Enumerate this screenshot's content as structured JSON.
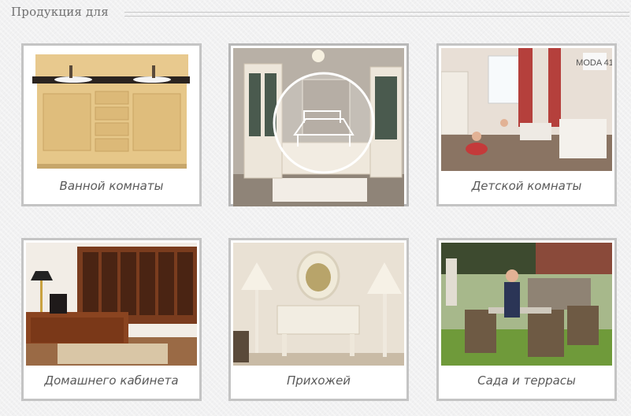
{
  "header": {
    "title": "Продукция для"
  },
  "products": [
    {
      "caption": "Ванной комнаты",
      "icon": "bathroom-vanity-image"
    },
    {
      "caption": "",
      "icon": "living-room-showcase-image"
    },
    {
      "caption": "Детской комнаты",
      "icon": "kids-room-image",
      "badge_text": "MODA 41"
    },
    {
      "caption": "Домашнего кабинета",
      "icon": "home-office-image"
    },
    {
      "caption": "Прихожей",
      "icon": "hallway-console-image"
    },
    {
      "caption": "Сада и террасы",
      "icon": "garden-terrace-image"
    }
  ]
}
